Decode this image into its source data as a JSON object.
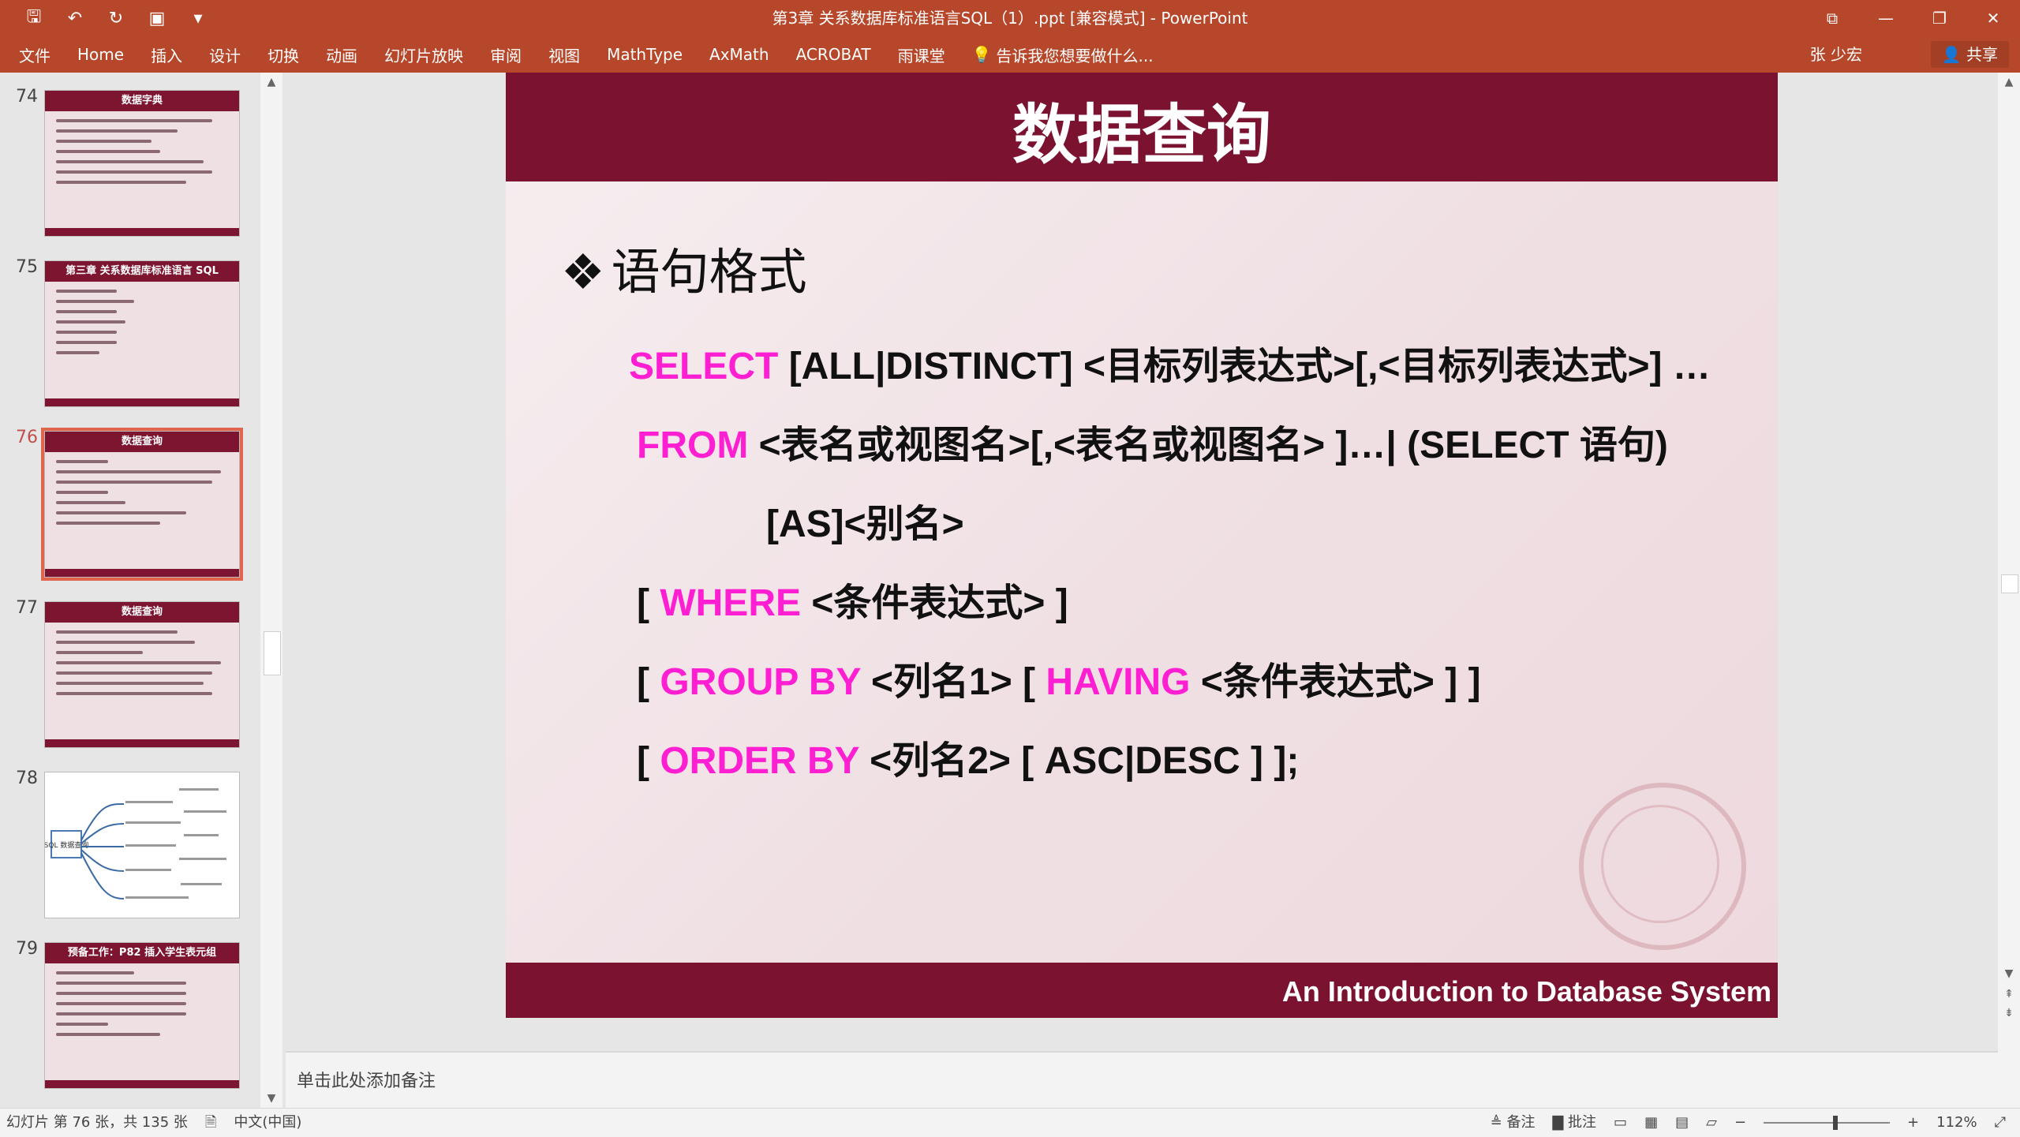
{
  "window": {
    "title": "第3章 关系数据库标准语言SQL（1）.ppt [兼容模式] - PowerPoint",
    "quick_access": [
      "save-icon",
      "undo-icon",
      "redo-icon",
      "present-icon",
      "customize-icon"
    ]
  },
  "ribbon": {
    "tabs": [
      "文件",
      "Home",
      "插入",
      "设计",
      "切换",
      "动画",
      "幻灯片放映",
      "审阅",
      "视图",
      "MathType",
      "AxMath",
      "ACROBAT",
      "雨课堂"
    ],
    "tell_me": "告诉我您想要做什么...",
    "user": "张 少宏",
    "share": "共享"
  },
  "thumbnails": [
    {
      "num": "74",
      "title": "数据字典"
    },
    {
      "num": "75",
      "title": "第三章 关系数据库标准语言 SQL"
    },
    {
      "num": "76",
      "title": "数据查询",
      "active": true
    },
    {
      "num": "77",
      "title": "数据查询"
    },
    {
      "num": "78",
      "title": "SQL 数据查询"
    },
    {
      "num": "79",
      "title": "预备工作：P82 插入学生表元组"
    }
  ],
  "slide": {
    "title": "数据查询",
    "heading": "语句格式",
    "heading_bullet": "❖",
    "lines": [
      {
        "kw": "SELECT",
        "rest": " [ALL|DISTINCT] <目标列表达式>[,<目标列表达式>] …"
      },
      {
        "kw": "FROM",
        "rest": " <表名或视图名>[,<表名或视图名> ]…| (SELECT 语句)"
      },
      {
        "kw": "",
        "rest": "[AS]<别名>"
      },
      {
        "pre": "[ ",
        "kw": "WHERE",
        "rest": " <条件表达式> ]"
      },
      {
        "pre": "[ ",
        "kw": "GROUP BY",
        "mid": " <列名1> [ ",
        "kw2": "HAVING",
        "rest": " <条件表达式> ] ]"
      },
      {
        "pre": "[ ",
        "kw": "ORDER BY",
        "rest": " <列名2> [ ASC|DESC ] ];"
      }
    ],
    "footer": "An Introduction to Database System"
  },
  "notes": {
    "placeholder": "单击此处添加备注"
  },
  "status": {
    "slide_info": "幻灯片 第 76 张，共 135 张",
    "language": "中文(中国)",
    "notes_btn": "备注",
    "comments_btn": "批注",
    "zoom": "112%"
  }
}
